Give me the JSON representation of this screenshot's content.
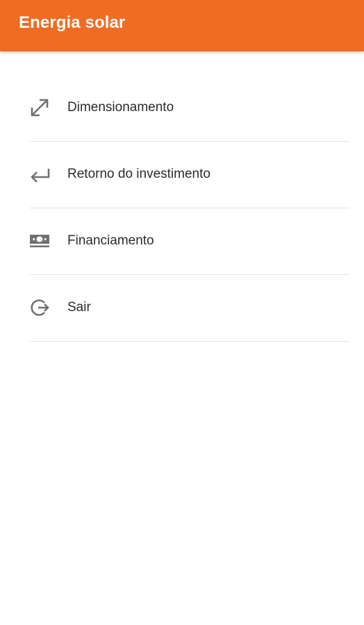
{
  "header": {
    "title": "Energia solar",
    "color": "#ef6c22"
  },
  "menu": {
    "items": [
      {
        "label": "Dimensionamento",
        "icon": "diagonal-resize-arrows-icon"
      },
      {
        "label": "Retorno do investimento",
        "icon": "return-arrow-icon"
      },
      {
        "label": "Financiamento",
        "icon": "money-banknote-icon"
      },
      {
        "label": "Sair",
        "icon": "exit-icon"
      }
    ]
  }
}
